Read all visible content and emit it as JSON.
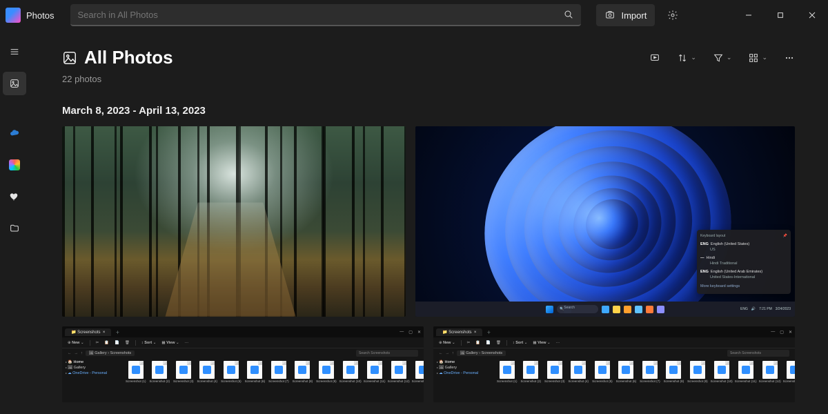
{
  "app": {
    "title": "Photos",
    "search_placeholder": "Search in All Photos",
    "import_label": "Import"
  },
  "page": {
    "title": "All Photos",
    "count": "22 photos",
    "date_range": "March 8, 2023 - April 13, 2023"
  },
  "sidebar": {
    "items": [
      "menu",
      "all-photos",
      "onedrive",
      "icloud",
      "favorites",
      "folders"
    ]
  },
  "bloom": {
    "kbd_header": "Keyboard layout",
    "langs": [
      {
        "code": "ENG",
        "name": "English (United States)",
        "sub": "US"
      },
      {
        "code": "—",
        "name": "Hindi",
        "sub": "Hindi Traditional"
      },
      {
        "code": "ENG",
        "name": "English (United Arab Emirates)",
        "sub": "United States-International"
      }
    ],
    "more": "More keyboard settings",
    "search": "Search",
    "time": "7:21 PM",
    "date": "3/24/2023"
  },
  "explorer": {
    "tab": "Screenshots",
    "new": "New",
    "sort": "Sort",
    "view": "View",
    "dots": "···",
    "home": "Home",
    "gallery": "Gallery",
    "crumb": "Screenshots",
    "search_hint": "Search Screenshots",
    "side1": "Home",
    "side2": "Gallery",
    "side3": "OneDrive - Personal",
    "file_prefix": "Screenshot"
  }
}
